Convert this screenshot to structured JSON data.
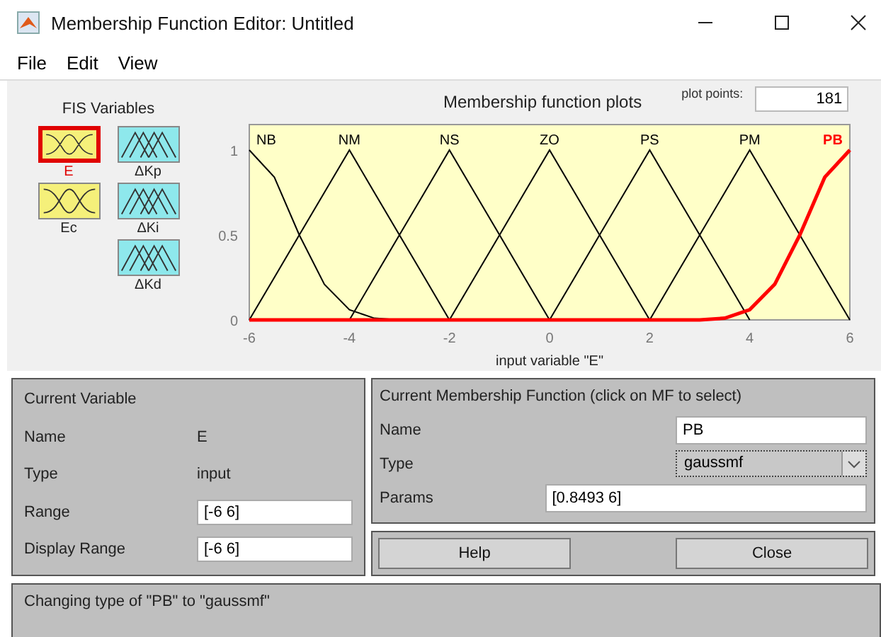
{
  "window": {
    "title": "Membership Function Editor: Untitled"
  },
  "menu": [
    "File",
    "Edit",
    "View"
  ],
  "fis_variables": {
    "title": "FIS Variables",
    "inputs": [
      {
        "label": "E",
        "selected": true
      },
      {
        "label": "Ec",
        "selected": false
      }
    ],
    "outputs": [
      {
        "label": "ΔKp",
        "selected": false
      },
      {
        "label": "ΔKi",
        "selected": false
      },
      {
        "label": "ΔKd",
        "selected": false
      }
    ]
  },
  "plot": {
    "title": "Membership function plots",
    "plot_points_label": "plot points:",
    "plot_points": "181",
    "chart_data": {
      "type": "line",
      "xlabel": "input variable \"E\"",
      "x": [
        -6,
        -5.5,
        -5,
        -4.5,
        -4,
        -3.5,
        -3,
        -2.5,
        -2,
        -1.5,
        -1,
        -0.5,
        0,
        0.5,
        1,
        1.5,
        2,
        2.5,
        3,
        3.5,
        4,
        4.5,
        5,
        5.5,
        6
      ],
      "series": [
        {
          "name": "NB",
          "color": "#000000",
          "values": [
            1,
            0.84,
            0.5,
            0.21,
            0.06,
            0.01,
            0,
            null,
            null,
            null,
            null,
            null,
            null,
            null,
            null,
            null,
            null,
            null,
            null,
            null,
            null,
            null,
            null,
            null,
            null
          ]
        },
        {
          "name": "NM",
          "color": "#000000",
          "values": [
            0,
            0.25,
            0.5,
            0.75,
            1,
            0.75,
            0.5,
            0.25,
            0,
            null,
            null,
            null,
            null,
            null,
            null,
            null,
            null,
            null,
            null,
            null,
            null,
            null,
            null,
            null,
            null
          ]
        },
        {
          "name": "NS",
          "color": "#000000",
          "values": [
            null,
            null,
            null,
            null,
            0,
            0.25,
            0.5,
            0.75,
            1,
            0.75,
            0.5,
            0.25,
            0,
            null,
            null,
            null,
            null,
            null,
            null,
            null,
            null,
            null,
            null,
            null,
            null
          ]
        },
        {
          "name": "ZO",
          "color": "#000000",
          "values": [
            null,
            null,
            null,
            null,
            null,
            null,
            null,
            null,
            0,
            0.25,
            0.5,
            0.75,
            1,
            0.75,
            0.5,
            0.25,
            0,
            null,
            null,
            null,
            null,
            null,
            null,
            null,
            null
          ]
        },
        {
          "name": "PS",
          "color": "#000000",
          "values": [
            null,
            null,
            null,
            null,
            null,
            null,
            null,
            null,
            null,
            null,
            null,
            null,
            0,
            0.25,
            0.5,
            0.75,
            1,
            0.75,
            0.5,
            0.25,
            0,
            null,
            null,
            null,
            null
          ]
        },
        {
          "name": "PM",
          "color": "#000000",
          "values": [
            null,
            null,
            null,
            null,
            null,
            null,
            null,
            null,
            null,
            null,
            null,
            null,
            null,
            null,
            null,
            null,
            0,
            0.25,
            0.5,
            0.75,
            1,
            0.75,
            0.5,
            0.25,
            0
          ]
        },
        {
          "name": "PB",
          "color": "#ff0000",
          "values": [
            0,
            0,
            0,
            0,
            0,
            0,
            0,
            0,
            0,
            0,
            0,
            0,
            0,
            0,
            0,
            0,
            0,
            0,
            0,
            0.01,
            0.06,
            0.21,
            0.5,
            0.84,
            1
          ]
        }
      ],
      "xlim": [
        -6,
        6
      ],
      "ylim": [
        0,
        1.15
      ],
      "xticks": [
        -6,
        -4,
        -2,
        0,
        2,
        4,
        6
      ],
      "yticks": [
        0,
        0.5,
        1
      ]
    }
  },
  "current_variable": {
    "title": "Current Variable",
    "name_label": "Name",
    "name": "E",
    "type_label": "Type",
    "type": "input",
    "range_label": "Range",
    "range": "[-6 6]",
    "display_range_label": "Display Range",
    "display_range": "[-6 6]"
  },
  "current_mf": {
    "title": "Current Membership Function (click on MF to select)",
    "name_label": "Name",
    "name": "PB",
    "type_label": "Type",
    "type": "gaussmf",
    "params_label": "Params",
    "params": "[0.8493 6]"
  },
  "buttons": [
    "Help",
    "Close"
  ],
  "status": "Changing type of \"PB\" to \"gaussmf\""
}
